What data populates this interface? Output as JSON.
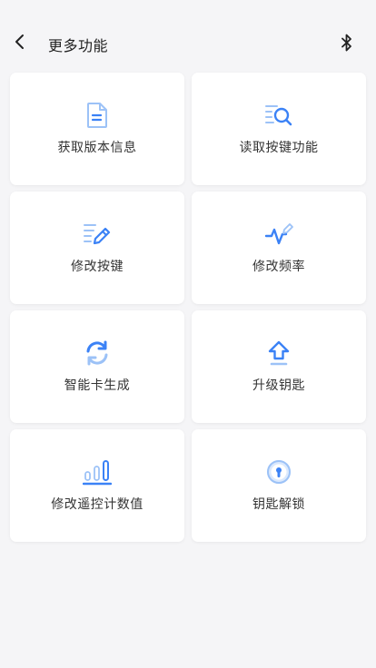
{
  "header": {
    "title": "更多功能",
    "back_icon": "chevron-left-icon",
    "bluetooth_icon": "bluetooth-icon"
  },
  "colors": {
    "accent": "#3b82f6",
    "accent_light": "#9cc2f7",
    "background": "#f5f5f7",
    "card": "#ffffff"
  },
  "features": [
    {
      "label": "获取版本信息",
      "icon": "document-icon"
    },
    {
      "label": "读取按键功能",
      "icon": "list-search-icon"
    },
    {
      "label": "修改按键",
      "icon": "list-edit-icon"
    },
    {
      "label": "修改频率",
      "icon": "pulse-edit-icon"
    },
    {
      "label": "智能卡生成",
      "icon": "refresh-icon"
    },
    {
      "label": "升级钥匙",
      "icon": "upload-arrow-icon"
    },
    {
      "label": "修改遥控计数值",
      "icon": "bar-chart-icon"
    },
    {
      "label": "钥匙解锁",
      "icon": "keyhole-icon"
    }
  ]
}
